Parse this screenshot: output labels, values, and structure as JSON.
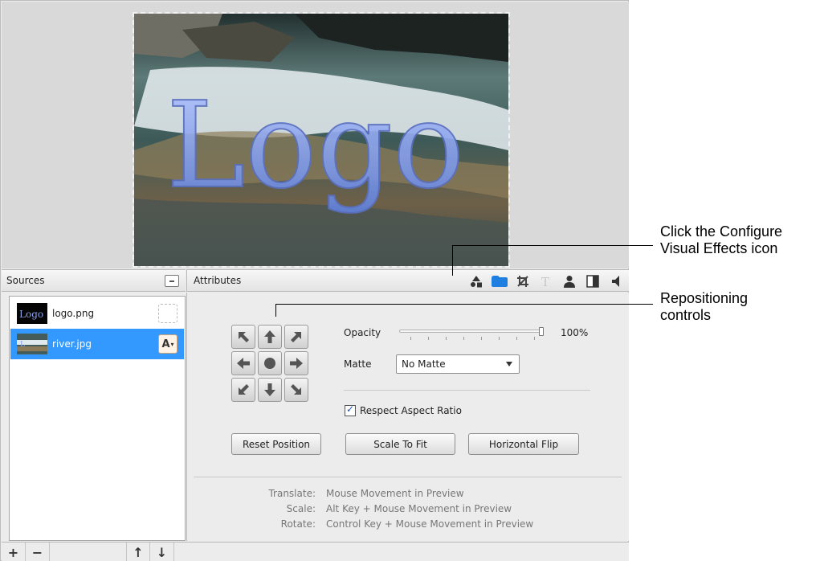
{
  "preview": {
    "overlay_text": "Logo"
  },
  "sources": {
    "header": "Sources",
    "items": [
      {
        "name": "logo.png",
        "thumb_text": "Logo",
        "selected": false
      },
      {
        "name": "river.jpg",
        "selected": true,
        "mark": "A"
      }
    ],
    "bottom_buttons": {
      "add": "+",
      "remove": "−",
      "move_up": "↑",
      "move_down": "↓"
    }
  },
  "attributes": {
    "header": "Attributes",
    "tabs": [
      "object-tab-icon",
      "visual-effects-icon",
      "crop-icon",
      "text-icon",
      "person-icon",
      "contrast-icon",
      "audio-icon"
    ],
    "opacity_label": "Opacity",
    "opacity_value": "100%",
    "opacity_level": 1.0,
    "matte_label": "Matte",
    "matte_value": "No Matte",
    "respect_aspect_label": "Respect Aspect Ratio",
    "respect_aspect_checked": true,
    "reset_position_label": "Reset Position",
    "scale_to_fit_label": "Scale To Fit",
    "horizontal_flip_label": "Horizontal Flip",
    "help": [
      {
        "key": "Translate:",
        "value": "Mouse Movement in Preview"
      },
      {
        "key": "Scale:",
        "value": "Alt Key + Mouse Movement in Preview"
      },
      {
        "key": "Rotate:",
        "value": "Control Key + Mouse Movement in Preview"
      }
    ]
  },
  "annotations": {
    "visual_effects": [
      "Click the Configure",
      "Visual Effects icon"
    ],
    "repositioning": [
      "Repositioning",
      "controls"
    ]
  },
  "colors": {
    "selection": "#3399ff",
    "accent_tab": "#1e7fe0"
  }
}
